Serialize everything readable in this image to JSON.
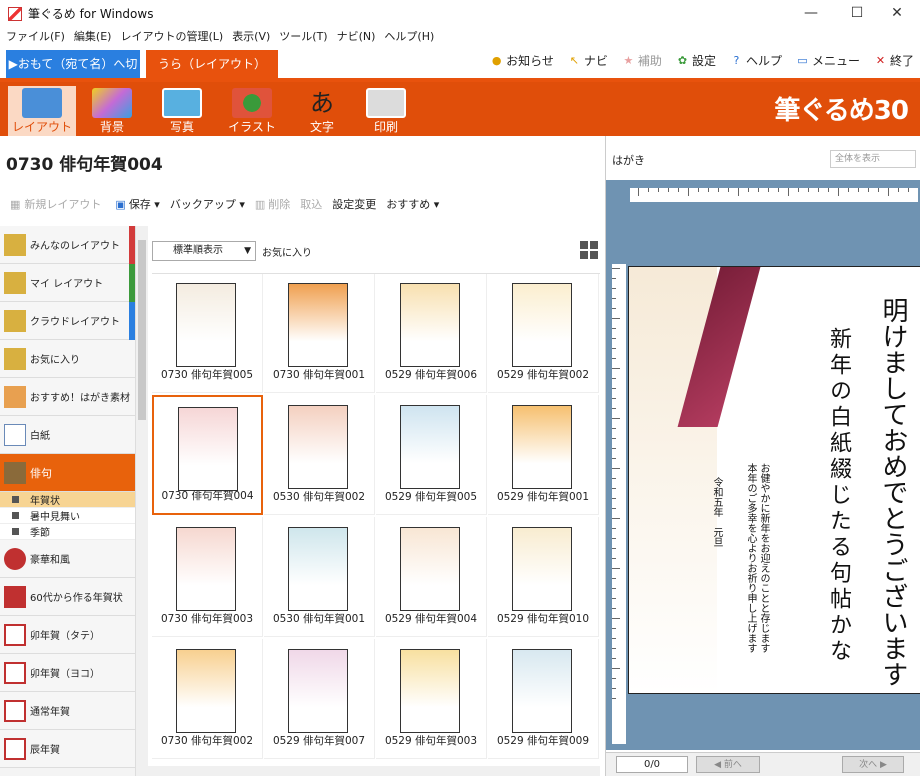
{
  "window": {
    "title": "筆ぐるめ for Windows",
    "controls": [
      "—",
      "☐",
      "✕"
    ]
  },
  "menu": [
    "ファイル(F)",
    "編集(E)",
    "レイアウトの管理(L)",
    "表示(V)",
    "ツール(T)",
    "ナビ(N)",
    "ヘルプ(H)"
  ],
  "tabs": {
    "front": "▶おもて（宛て名）へ切替",
    "back": "うら（レイアウト）"
  },
  "toplinks": [
    {
      "label": "お知らせ",
      "icon": "bell-icon"
    },
    {
      "label": "ナビ",
      "icon": "pointer-icon"
    },
    {
      "label": "補助",
      "icon": "star-icon"
    },
    {
      "label": "設定",
      "icon": "gear-icon"
    },
    {
      "label": "ヘルプ",
      "icon": "help-icon"
    },
    {
      "label": "メニュー",
      "icon": "window-icon"
    },
    {
      "label": "終了",
      "icon": "close-icon"
    }
  ],
  "toolbar": {
    "buttons": [
      {
        "label": "レイアウト",
        "icon": "layout-icon",
        "color": "#4a8fd8"
      },
      {
        "label": "背景",
        "icon": "background-icon",
        "color": "#c46bd6"
      },
      {
        "label": "写真",
        "icon": "photo-icon",
        "color": "#58b0e0"
      },
      {
        "label": "イラスト",
        "icon": "illustration-icon",
        "color": "#e0533b"
      },
      {
        "label": "文字",
        "icon": "text-icon",
        "color": "#222222"
      },
      {
        "label": "印刷",
        "icon": "printer-icon",
        "color": "#cfcfcf"
      }
    ],
    "brand": "筆ぐるめ30"
  },
  "page_title": "0730 俳句年賀004",
  "layout_toolbar": [
    {
      "label": "新規レイアウト",
      "enabled": false
    },
    {
      "label": "保存 ▾",
      "enabled": true
    },
    {
      "label": "バックアップ ▾",
      "enabled": true
    },
    {
      "label": "削除",
      "enabled": false
    },
    {
      "label": "取込",
      "enabled": false
    },
    {
      "label": "設定変更",
      "enabled": true
    },
    {
      "label": "おすすめ ▾",
      "enabled": true
    }
  ],
  "sidebar": {
    "items": [
      {
        "label": "みんなのレイアウト",
        "bar_color": "#d23b3b"
      },
      {
        "label": "マイ レイアウト",
        "bar_color": "#3c9a3c"
      },
      {
        "label": "クラウドレイアウト",
        "bar_color": "#2a7fe0"
      },
      {
        "label": "お気に入り",
        "bar_color": ""
      },
      {
        "label": "おすすめ！はがき素材",
        "bar_color": ""
      },
      {
        "label": "白紙",
        "bar_color": ""
      },
      {
        "label": "俳句",
        "bar_color": ""
      }
    ],
    "subitems": [
      "年賀状",
      "暑中見舞い",
      "季節"
    ],
    "more": [
      "豪華和風",
      "60代から作る年賀状",
      "卯年賀（タテ）",
      "卯年賀（ヨコ）",
      "通常年賀",
      "辰年賀"
    ]
  },
  "grid": {
    "sort_label": "標準順表示",
    "fav_label": "お気に入り",
    "cards": [
      "0730 俳句年賀005",
      "0730 俳句年賀001",
      "0529 俳句年賀006",
      "0529 俳句年賀002",
      "0730 俳句年賀004",
      "0530 俳句年賀002",
      "0529 俳句年賀005",
      "0529 俳句年賀001",
      "0730 俳句年賀003",
      "0530 俳句年賀001",
      "0529 俳句年賀004",
      "0529 俳句年賀010",
      "0730 俳句年賀002",
      "0529 俳句年賀007",
      "0529 俳句年賀003",
      "0529 俳句年賀009"
    ],
    "selected_index": 4
  },
  "preview": {
    "card_type": "はがき",
    "view_select": "全体を表示",
    "greeting": "明けましておめでとうございます",
    "haiku": "新年の白紙綴じたる句帖かな",
    "message": [
      "お健やかに新年をお迎えのことと存じます",
      "本年のご多幸を心よりお祈り申し上げます"
    ],
    "date": "令和五年　元旦",
    "page_num": "0/0",
    "prev_label": "◀ 前へ",
    "next_label": "次へ ▶"
  }
}
